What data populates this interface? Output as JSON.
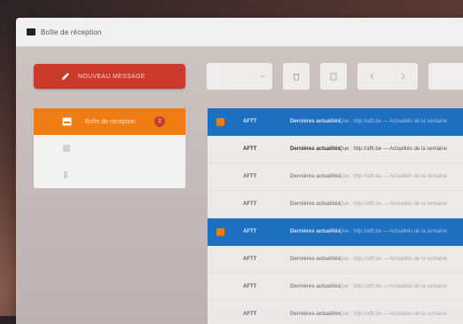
{
  "window": {
    "title": "Boîte de réception"
  },
  "compose": {
    "label": "NOUVEAU MESSAGE"
  },
  "toolbar": {
    "select_label": ""
  },
  "sidebar": {
    "items": [
      {
        "label": "Boîte de réception",
        "badge": "2",
        "active": true
      },
      {
        "label": "",
        "active": false
      },
      {
        "label": "",
        "active": false
      }
    ]
  },
  "messages": [
    {
      "sender": "AFTT",
      "subject": "Dernières actualités",
      "preview": "Que : http://aftt.be — Actualités de la semaine",
      "selected": true,
      "unread": false
    },
    {
      "sender": "AFTT",
      "subject": "Dernières actualités",
      "preview": "Que : http://aftt.be — Actualités de la semaine",
      "selected": false,
      "unread": true
    },
    {
      "sender": "AFTT",
      "subject": "Dernières actualités",
      "preview": "Que : http://aftt.be — Actualités de la semaine",
      "selected": false,
      "unread": false
    },
    {
      "sender": "AFTT",
      "subject": "Dernières actualités",
      "preview": "Que : http://aftt.be — Actualités de la semaine",
      "selected": false,
      "unread": false
    },
    {
      "sender": "AFTT",
      "subject": "Dernières actualités",
      "preview": "Que : http://aftt.be — Actualités de la semaine",
      "selected": true,
      "unread": false
    },
    {
      "sender": "AFTT",
      "subject": "Dernières actualités",
      "preview": "Que : http://aftt.be — Actualités de la semaine",
      "selected": false,
      "unread": false
    },
    {
      "sender": "AFTT",
      "subject": "Dernières actualités",
      "preview": "Que : http://aftt.be — Actualités de la semaine",
      "selected": false,
      "unread": false
    },
    {
      "sender": "AFTT",
      "subject": "Dernières actualités",
      "preview": "Que : http://aftt.be — Actualités de la semaine",
      "selected": false,
      "unread": false
    }
  ],
  "colors": {
    "accent_orange": "#f07d14",
    "accent_blue": "#1f6fc0",
    "compose_red": "#c9392c"
  },
  "icons": [
    "app-icon",
    "pencil-icon",
    "chevron-down-icon",
    "trash-icon",
    "archive-icon",
    "arrow-left-icon",
    "arrow-right-icon",
    "inbox-icon",
    "folder-icon",
    "file-icon"
  ]
}
